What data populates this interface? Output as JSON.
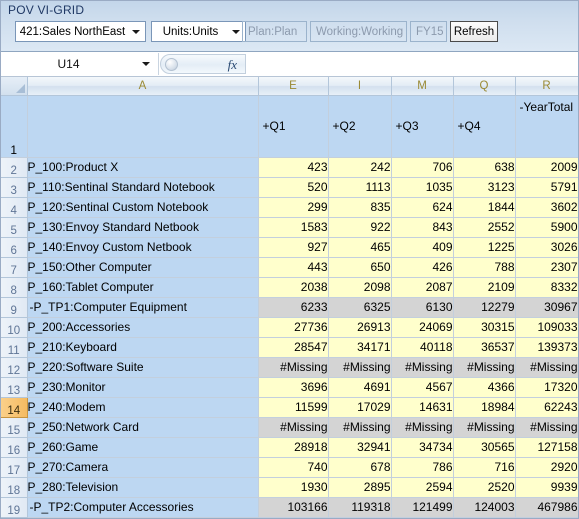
{
  "pov": {
    "title": "POV VI-GRID",
    "entity": "421:Sales NorthEast",
    "measure": "Units:Units",
    "scenario": "Plan:Plan",
    "version": "Working:Working",
    "year": "FY15",
    "refresh_label": "Refresh"
  },
  "formula_bar": {
    "name_box": "U14",
    "fx_label": "fx",
    "formula": ""
  },
  "grid": {
    "column_letters": [
      "A",
      "E",
      "I",
      "M",
      "Q",
      "R"
    ],
    "header_row_number": "1",
    "column_headers": [
      "",
      "+Q1",
      "+Q2",
      "+Q3",
      "+Q4",
      "-YearTotal"
    ],
    "rows": [
      {
        "num": "2",
        "selected": false,
        "style": "data",
        "member": "P_100:Product X",
        "values": [
          "423",
          "242",
          "706",
          "638",
          "2009"
        ]
      },
      {
        "num": "3",
        "selected": false,
        "style": "data",
        "member": "P_110:Sentinal Standard Notebook",
        "values": [
          "520",
          "1113",
          "1035",
          "3123",
          "5791"
        ]
      },
      {
        "num": "4",
        "selected": false,
        "style": "data",
        "member": "P_120:Sentinal Custom Notebook",
        "values": [
          "299",
          "835",
          "624",
          "1844",
          "3602"
        ]
      },
      {
        "num": "5",
        "selected": false,
        "style": "data",
        "member": "P_130:Envoy Standard Netbook",
        "values": [
          "1583",
          "922",
          "843",
          "2552",
          "5900"
        ]
      },
      {
        "num": "6",
        "selected": false,
        "style": "data",
        "member": "P_140:Envoy Custom Netbook",
        "values": [
          "927",
          "465",
          "409",
          "1225",
          "3026"
        ]
      },
      {
        "num": "7",
        "selected": false,
        "style": "data",
        "member": "P_150:Other Computer",
        "values": [
          "443",
          "650",
          "426",
          "788",
          "2307"
        ]
      },
      {
        "num": "8",
        "selected": false,
        "style": "data",
        "member": "P_160:Tablet Computer",
        "values": [
          "2038",
          "2098",
          "2087",
          "2109",
          "8332"
        ]
      },
      {
        "num": "9",
        "selected": false,
        "style": "total",
        "member": "-P_TP1:Computer Equipment",
        "values": [
          "6233",
          "6325",
          "6130",
          "12279",
          "30967"
        ]
      },
      {
        "num": "10",
        "selected": false,
        "style": "data",
        "member": "P_200:Accessories",
        "values": [
          "27736",
          "26913",
          "24069",
          "30315",
          "109033"
        ]
      },
      {
        "num": "11",
        "selected": false,
        "style": "data",
        "member": "P_210:Keyboard",
        "values": [
          "28547",
          "34171",
          "40118",
          "36537",
          "139373"
        ]
      },
      {
        "num": "12",
        "selected": false,
        "style": "missing",
        "member": "P_220:Software Suite",
        "values": [
          "#Missing",
          "#Missing",
          "#Missing",
          "#Missing",
          "#Missing"
        ]
      },
      {
        "num": "13",
        "selected": false,
        "style": "data",
        "member": "P_230:Monitor",
        "values": [
          "3696",
          "4691",
          "4567",
          "4366",
          "17320"
        ]
      },
      {
        "num": "14",
        "selected": true,
        "style": "data",
        "member": "P_240:Modem",
        "values": [
          "11599",
          "17029",
          "14631",
          "18984",
          "62243"
        ]
      },
      {
        "num": "15",
        "selected": false,
        "style": "missing",
        "member": "P_250:Network Card",
        "values": [
          "#Missing",
          "#Missing",
          "#Missing",
          "#Missing",
          "#Missing"
        ]
      },
      {
        "num": "16",
        "selected": false,
        "style": "data",
        "member": "P_260:Game",
        "values": [
          "28918",
          "32941",
          "34734",
          "30565",
          "127158"
        ]
      },
      {
        "num": "17",
        "selected": false,
        "style": "data",
        "member": "P_270:Camera",
        "values": [
          "740",
          "678",
          "786",
          "716",
          "2920"
        ]
      },
      {
        "num": "18",
        "selected": false,
        "style": "data",
        "member": "P_280:Television",
        "values": [
          "1930",
          "2895",
          "2594",
          "2520",
          "9939"
        ]
      },
      {
        "num": "19",
        "selected": false,
        "style": "total",
        "member": "-P_TP2:Computer Accessories",
        "values": [
          "103166",
          "119318",
          "121499",
          "124003",
          "467986"
        ]
      }
    ]
  },
  "colors": {
    "pov_bar": "#cfdeee",
    "member_cell": "#bdd7f2",
    "data_cell": "#ffffcc",
    "total_cell": "#d4d4d4",
    "selected_row_header": "#f5bb62",
    "column_letter": "#9a8a34"
  }
}
